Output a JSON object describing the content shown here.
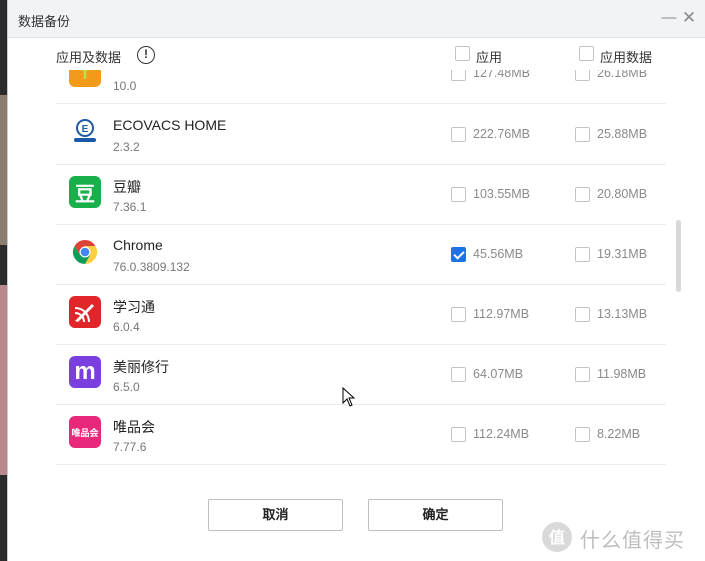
{
  "window": {
    "title": "数据备份"
  },
  "header": {
    "apps_label": "应用及数据",
    "app_col": "应用",
    "data_col": "应用数据"
  },
  "apps": [
    {
      "name": "...",
      "version": "10.0",
      "app_size": "127.48MB",
      "data_size": "26.18MB",
      "app_checked": false,
      "data_checked": false,
      "icon": "sprout-icon",
      "color": "#f29a1a"
    },
    {
      "name": "ECOVACS HOME",
      "version": "2.3.2",
      "app_size": "222.76MB",
      "data_size": "25.88MB",
      "app_checked": false,
      "data_checked": false,
      "icon": "ecovacs-icon",
      "color": "#ffffff"
    },
    {
      "name": "豆瓣",
      "version": "7.36.1",
      "app_size": "103.55MB",
      "data_size": "20.80MB",
      "app_checked": false,
      "data_checked": false,
      "icon": "douban-icon",
      "color": "#17b04b"
    },
    {
      "name": "Chrome",
      "version": "76.0.3809.132",
      "app_size": "45.56MB",
      "data_size": "19.31MB",
      "app_checked": true,
      "data_checked": false,
      "icon": "chrome-icon",
      "color": "#ffffff"
    },
    {
      "name": "学习通",
      "version": "6.0.4",
      "app_size": "112.97MB",
      "data_size": "13.13MB",
      "app_checked": false,
      "data_checked": false,
      "icon": "xuexitong-icon",
      "color": "#e0262b"
    },
    {
      "name": "美丽修行",
      "version": "6.5.0",
      "app_size": "64.07MB",
      "data_size": "11.98MB",
      "app_checked": false,
      "data_checked": false,
      "icon": "meilixiuxing-icon",
      "color": "#7b3fe0"
    },
    {
      "name": "唯品会",
      "version": "7.77.6",
      "app_size": "112.24MB",
      "data_size": "8.22MB",
      "app_checked": false,
      "data_checked": false,
      "icon": "vipshop-icon",
      "color": "#e8287a"
    }
  ],
  "buttons": {
    "cancel": "取消",
    "ok": "确定"
  },
  "watermark": {
    "text": "什么值得买"
  },
  "icon_text": {
    "douban": "豆",
    "meilixiuxing": "m",
    "vipshop": "唯品会",
    "ecovacs": "E"
  }
}
